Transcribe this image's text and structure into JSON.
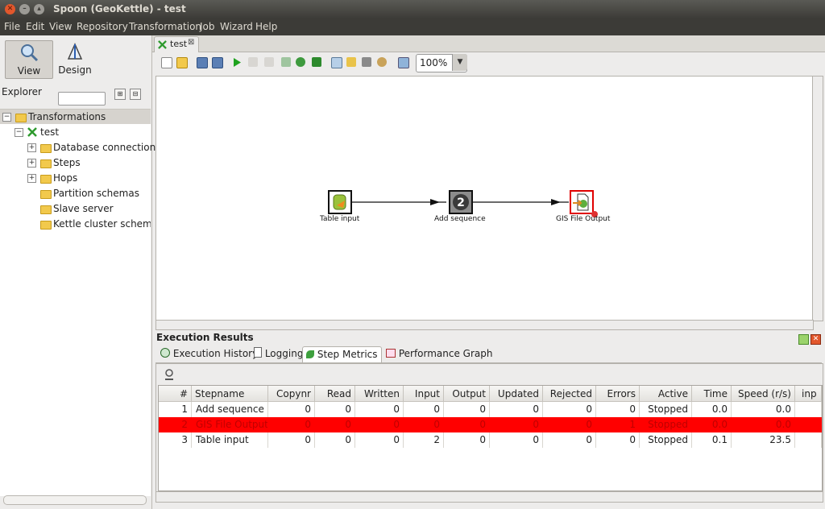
{
  "window": {
    "title": "Spoon (GeoKettle) - test"
  },
  "menu": [
    "File",
    "Edit",
    "View",
    "Repository",
    "Transformation",
    "Job",
    "Wizard",
    "Help"
  ],
  "perspectives": {
    "view": "View",
    "design": "Design"
  },
  "explorer": {
    "label": "Explorer"
  },
  "tree": {
    "root": "Transformations",
    "transformation": "test",
    "items": [
      "Database connections",
      "Steps",
      "Hops",
      "Partition schemas",
      "Slave server",
      "Kettle cluster schemas"
    ]
  },
  "tab": {
    "label": "test"
  },
  "toolbar": {
    "zoom": "100%"
  },
  "canvas": {
    "steps": [
      "Table input",
      "Add sequence",
      "GIS File Output"
    ],
    "sequence_badge": "2"
  },
  "execution": {
    "title": "Execution Results",
    "tabs": [
      "Execution History",
      "Logging",
      "Step Metrics",
      "Performance Graph"
    ],
    "active_tab": "Step Metrics"
  },
  "metrics": {
    "columns": [
      "#",
      "Stepname",
      "Copynr",
      "Read",
      "Written",
      "Input",
      "Output",
      "Updated",
      "Rejected",
      "Errors",
      "Active",
      "Time",
      "Speed (r/s)",
      "inp"
    ],
    "rows": [
      [
        "1",
        "Add sequence",
        "0",
        "0",
        "0",
        "0",
        "0",
        "0",
        "0",
        "0",
        "Stopped",
        "0.0",
        "0.0",
        ""
      ],
      [
        "2",
        "GIS File Output",
        "0",
        "0",
        "0",
        "0",
        "0",
        "0",
        "0",
        "1",
        "Stopped",
        "0.0",
        "0.0",
        ""
      ],
      [
        "3",
        "Table input",
        "0",
        "0",
        "0",
        "2",
        "0",
        "0",
        "0",
        "0",
        "Stopped",
        "0.1",
        "23.5",
        ""
      ]
    ],
    "error_row_color": "#ff0000"
  },
  "colors": {
    "titlebar": "#3c3b37",
    "close": "#e2572c",
    "folder": "#f2c94c"
  }
}
